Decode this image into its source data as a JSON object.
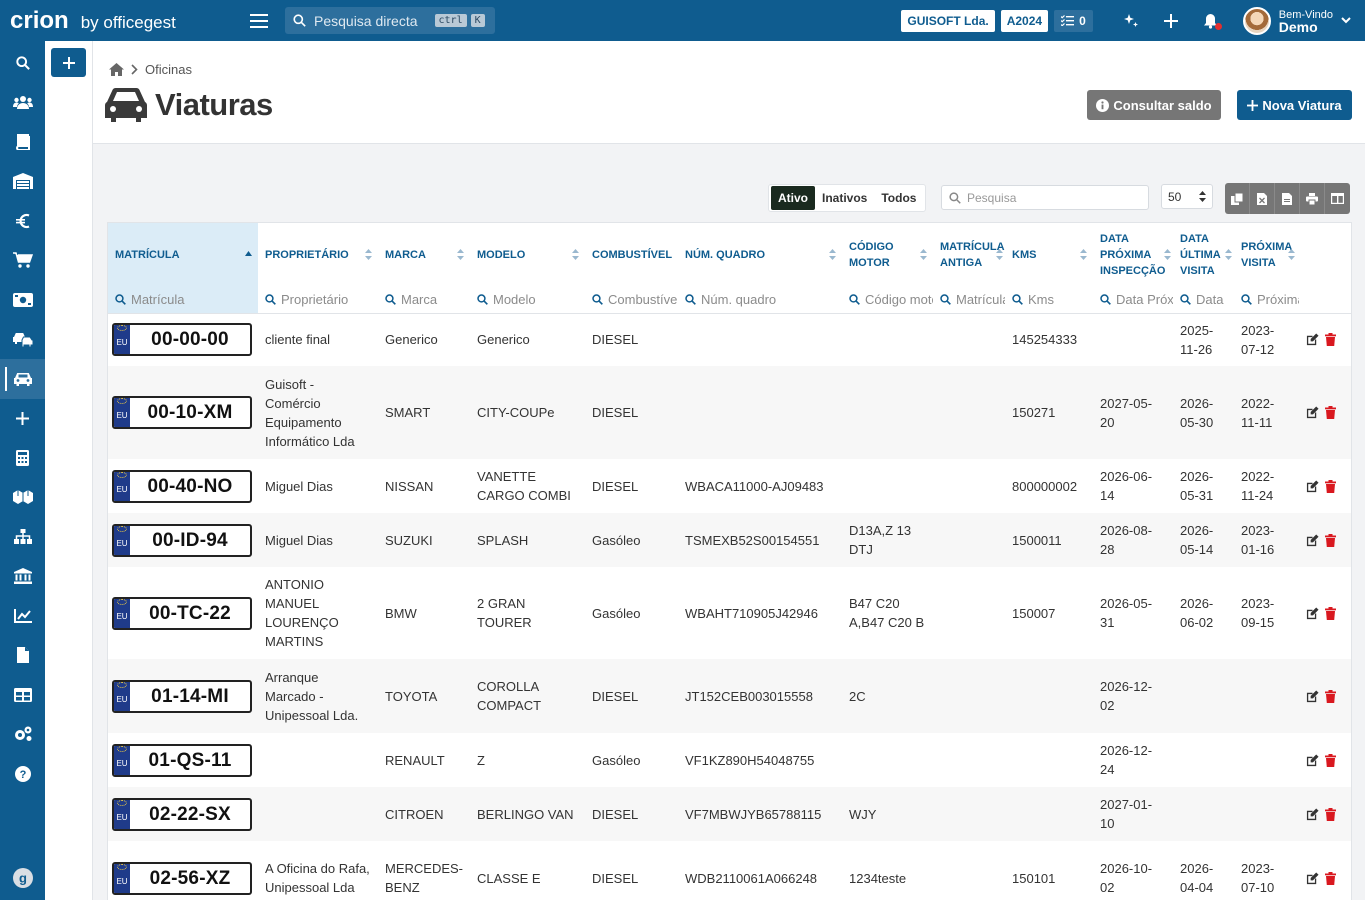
{
  "brand": {
    "logo": "crion",
    "by": "by officegest"
  },
  "topbar": {
    "search_placeholder": "Pesquisa directa",
    "kbd1": "ctrl",
    "kbd2": "K",
    "company": "GUISOFT Lda.",
    "year": "A2024",
    "tasks_count": "0",
    "greeting": "Bem-Vindo",
    "user": "Demo"
  },
  "sidebar": {
    "items": [
      "search-icon",
      "users-icon",
      "book-icon",
      "warehouse-icon",
      "euro-icon",
      "cart-icon",
      "cash-icon",
      "cars-icon",
      "car-icon",
      "plus-icon",
      "calculator-icon",
      "boxes-icon",
      "sitemap-icon",
      "bank-icon",
      "chart-icon",
      "file-icon",
      "table-icon",
      "gears-icon",
      "help-icon"
    ],
    "active": "car-icon"
  },
  "breadcrumb": {
    "section": "Oficinas"
  },
  "page": {
    "title": "Viaturas",
    "btn_saldo": "Consultar saldo",
    "btn_nova": "Nova Viatura"
  },
  "filters": {
    "options": [
      "Ativo",
      "Inativos",
      "Todos"
    ],
    "active": "Ativo",
    "search_placeholder": "Pesquisa",
    "page_size": "50"
  },
  "table": {
    "columns": [
      {
        "label": "MATRÍCULA",
        "filter": "Matrícula"
      },
      {
        "label": "PROPRIETÁRIO",
        "filter": "Proprietário"
      },
      {
        "label": "MARCA",
        "filter": "Marca"
      },
      {
        "label": "MODELO",
        "filter": "Modelo"
      },
      {
        "label": "COMBUSTÍVEL",
        "filter": "Combustível"
      },
      {
        "label": "NÚM. QUADRO",
        "filter": "Núm. quadro"
      },
      {
        "label": "CÓDIGO MOTOR",
        "filter": "Código motor"
      },
      {
        "label": "MATRÍCULA ANTIGA",
        "filter": "Matrícula"
      },
      {
        "label": "KMS",
        "filter": "Kms"
      },
      {
        "label": "DATA PRÓXIMA INSPECÇÃO",
        "filter": "Data Próxima"
      },
      {
        "label": "DATA ÚLTIMA VISITA",
        "filter": "Data"
      },
      {
        "label": "PRÓXIMA VISITA",
        "filter": "Próxima"
      }
    ],
    "plate_eu": "EU",
    "rows": [
      {
        "plate": "00-00-00",
        "owner": "cliente final",
        "brand": "Generico",
        "model": "Generico",
        "fuel": "DIESEL",
        "vin": "",
        "engine": "",
        "old_plate": "",
        "kms": "145254333",
        "next_insp": "",
        "last_visit": "2025-11-26",
        "next_visit": "2023-07-12"
      },
      {
        "plate": "00-10-XM",
        "owner": "Guisoft - Comércio Equipamento Informático Lda",
        "brand": "SMART",
        "model": "CITY-COUPe",
        "fuel": "DIESEL",
        "vin": "",
        "engine": "",
        "old_plate": "",
        "kms": "150271",
        "next_insp": "2027-05-20",
        "last_visit": "2026-05-30",
        "next_visit": "2022-11-11"
      },
      {
        "plate": "00-40-NO",
        "owner": "Miguel Dias",
        "brand": "NISSAN",
        "model": "VANETTE CARGO COMBI",
        "fuel": "DIESEL",
        "vin": "WBACA11000-AJ09483",
        "engine": "",
        "old_plate": "",
        "kms": "800000002",
        "next_insp": "2026-06-14",
        "last_visit": "2026-05-31",
        "next_visit": "2022-11-24"
      },
      {
        "plate": "00-ID-94",
        "owner": "Miguel Dias",
        "brand": "SUZUKI",
        "model": "SPLASH",
        "fuel": "Gasóleo",
        "vin": "TSMEXB52S00154551",
        "engine": "D13A,Z 13 DTJ",
        "old_plate": "",
        "kms": "1500011",
        "next_insp": "2026-08-28",
        "last_visit": "2026-05-14",
        "next_visit": "2023-01-16"
      },
      {
        "plate": "00-TC-22",
        "owner": "ANTONIO MANUEL LOURENÇO MARTINS",
        "brand": "BMW",
        "model": "2 GRAN TOURER",
        "fuel": "Gasóleo",
        "vin": "WBAHT710905J42946",
        "engine": "B47 C20 A,B47 C20 B",
        "old_plate": "",
        "kms": "150007",
        "next_insp": "2026-05-31",
        "last_visit": "2026-06-02",
        "next_visit": "2023-09-15"
      },
      {
        "plate": "01-14-MI",
        "owner": "Arranque Marcado - Unipessoal Lda.",
        "brand": "TOYOTA",
        "model": "COROLLA COMPACT",
        "fuel": "DIESEL",
        "vin": "JT152CEB003015558",
        "engine": "2C",
        "old_plate": "",
        "kms": "",
        "next_insp": "2026-12-02",
        "last_visit": "",
        "next_visit": ""
      },
      {
        "plate": "01-QS-11",
        "owner": "",
        "brand": "RENAULT",
        "model": "Z",
        "fuel": "Gasóleo",
        "vin": "VF1KZ890H54048755",
        "engine": "",
        "old_plate": "",
        "kms": "",
        "next_insp": "2026-12-24",
        "last_visit": "",
        "next_visit": ""
      },
      {
        "plate": "02-22-SX",
        "owner": "",
        "brand": "CITROEN",
        "model": "BERLINGO VAN",
        "fuel": "DIESEL",
        "vin": "VF7MBWJYB65788115",
        "engine": "WJY",
        "old_plate": "",
        "kms": "",
        "next_insp": "2027-01-10",
        "last_visit": "",
        "next_visit": ""
      },
      {
        "plate": "02-56-XZ",
        "owner": "A Oficina do Rafa, Unipessoal Lda",
        "brand": "MERCEDES-BENZ",
        "model": "CLASSE E",
        "fuel": "DIESEL",
        "vin": "WDB2110061A066248",
        "engine": "1234teste",
        "old_plate": "",
        "kms": "150101",
        "next_insp": "2026-10-02",
        "last_visit": "2026-04-04",
        "next_visit": "2023-07-10"
      }
    ]
  },
  "colors": {
    "primary": "#0f5c8f",
    "danger": "#d9181f",
    "grey_button": "#767676"
  }
}
